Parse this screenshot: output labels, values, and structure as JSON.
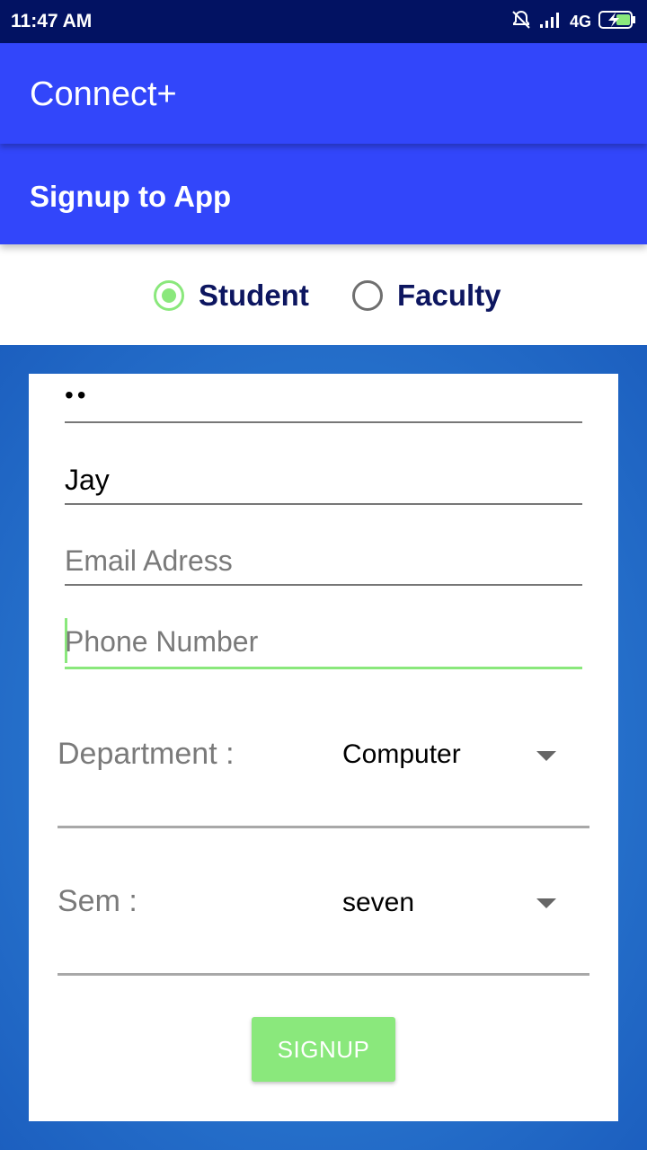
{
  "status_bar": {
    "time": "11:47 AM",
    "network": "4G",
    "icons": [
      "mute-alarm-icon",
      "signal-icon",
      "battery-charging-icon"
    ]
  },
  "app_bar": {
    "title": "Connect+"
  },
  "sub_bar": {
    "title": "Signup to App"
  },
  "role": {
    "options": [
      {
        "label": "Student",
        "checked": true
      },
      {
        "label": "Faculty",
        "checked": false
      }
    ]
  },
  "form": {
    "password_value": "••",
    "name_value": "Jay",
    "email_placeholder": "Email Adress",
    "phone_placeholder": "Phone Number",
    "department_label": "Department :",
    "department_value": "Computer",
    "sem_label": "Sem :",
    "sem_value": "seven",
    "signup_label": "SIGNUP"
  },
  "colors": {
    "status_bar": "#021262",
    "primary": "#3246fa",
    "accent": "#8ae87c",
    "role_text": "#0d1660"
  }
}
